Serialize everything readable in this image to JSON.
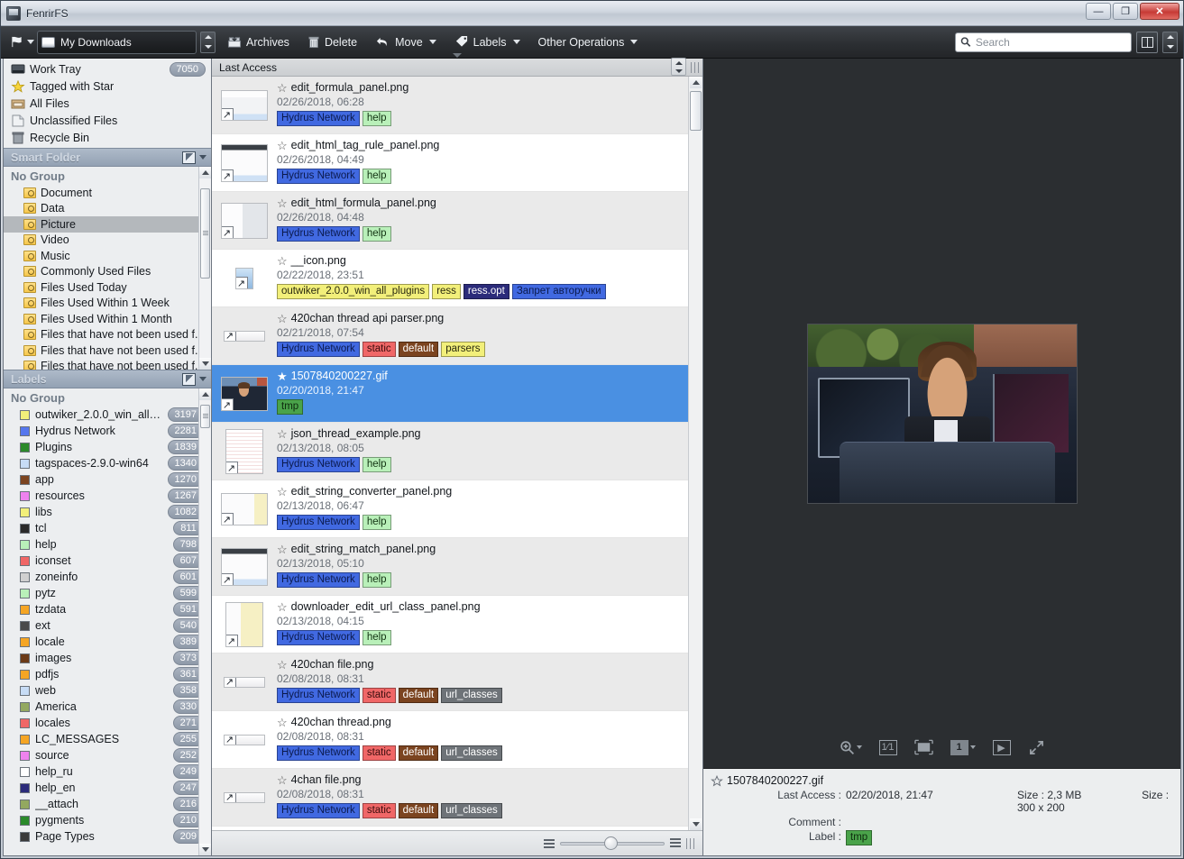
{
  "window": {
    "title": "FenrirFS",
    "app_icon": "app-icon",
    "buttons": {
      "minimize": "—",
      "maximize": "❐",
      "close": "✕"
    }
  },
  "toolbar": {
    "flag_icon": "flag-icon",
    "path_value": "My Downloads",
    "drive_icon": "drive-icon",
    "buttons": [
      {
        "label": "Archives",
        "icon": "archive-box-icon",
        "caret": false
      },
      {
        "label": "Delete",
        "icon": "trash-icon",
        "caret": false
      },
      {
        "label": "Move",
        "icon": "undo-arrow-icon",
        "caret": true
      },
      {
        "label": "Labels",
        "icon": "tag-icon",
        "caret": true
      },
      {
        "label": "Other Operations",
        "icon": "",
        "caret": true
      }
    ],
    "search": {
      "placeholder": "Search",
      "value": "",
      "icon": "search-icon"
    },
    "panel_toggle_icon": "split-panel-icon"
  },
  "sidebar": {
    "fixed_items": [
      {
        "label": "Work Tray",
        "icon": "tray-icon",
        "count": "7050"
      },
      {
        "label": "Tagged with Star",
        "icon": "star-icon",
        "count": ""
      },
      {
        "label": "All Files",
        "icon": "all-files-icon",
        "count": ""
      },
      {
        "label": "Unclassified Files",
        "icon": "unclassified-icon",
        "count": ""
      },
      {
        "label": "Recycle Bin",
        "icon": "recycle-bin-icon",
        "count": ""
      }
    ],
    "smart_folder": {
      "header": "Smart Folder",
      "group": "No Group"
    },
    "smart_items": [
      {
        "label": "Document"
      },
      {
        "label": "Data"
      },
      {
        "label": "Picture",
        "selected": true
      },
      {
        "label": "Video"
      },
      {
        "label": "Music"
      },
      {
        "label": "Commonly Used Files"
      },
      {
        "label": "Files Used Today"
      },
      {
        "label": "Files Used Within 1 Week"
      },
      {
        "label": "Files Used Within 1 Month"
      },
      {
        "label": "Files that have not been used f..."
      },
      {
        "label": "Files that have not been used f..."
      },
      {
        "label": "Files that have not been used f..."
      }
    ],
    "labels_section": {
      "header": "Labels",
      "group": "No Group"
    },
    "labels": [
      {
        "name": "outwiker_2.0.0_win_all_...",
        "count": "3197",
        "color": "#f2ef7a"
      },
      {
        "name": "Hydrus Network",
        "count": "2281",
        "color": "#5577ee"
      },
      {
        "name": "Plugins",
        "count": "1839",
        "color": "#2b8a2b"
      },
      {
        "name": "tagspaces-2.9.0-win64",
        "count": "1340",
        "color": "#c7dcf5"
      },
      {
        "name": "app",
        "count": "1270",
        "color": "#7b4420"
      },
      {
        "name": "resources",
        "count": "1267",
        "color": "#ee82ee"
      },
      {
        "name": "libs",
        "count": "1082",
        "color": "#f2ef7a"
      },
      {
        "name": "tcl",
        "count": "811",
        "color": "#2a2a2a"
      },
      {
        "name": "help",
        "count": "798",
        "color": "#b9f0b9"
      },
      {
        "name": "iconset",
        "count": "607",
        "color": "#f06767"
      },
      {
        "name": "zoneinfo",
        "count": "601",
        "color": "#d0d0d0"
      },
      {
        "name": "pytz",
        "count": "599",
        "color": "#b9f0b9"
      },
      {
        "name": "tzdata",
        "count": "591",
        "color": "#f5a524"
      },
      {
        "name": "ext",
        "count": "540",
        "color": "#4a4a4a"
      },
      {
        "name": "locale",
        "count": "389",
        "color": "#f5a524"
      },
      {
        "name": "images",
        "count": "373",
        "color": "#6b3a18"
      },
      {
        "name": "pdfjs",
        "count": "361",
        "color": "#f5a524"
      },
      {
        "name": "web",
        "count": "358",
        "color": "#c7dcf5"
      },
      {
        "name": "America",
        "count": "330",
        "color": "#93a860"
      },
      {
        "name": "locales",
        "count": "271",
        "color": "#f06767"
      },
      {
        "name": "LC_MESSAGES",
        "count": "255",
        "color": "#f5a524"
      },
      {
        "name": "source",
        "count": "252",
        "color": "#ee82ee"
      },
      {
        "name": "help_ru",
        "count": "249",
        "color": "#ffffff"
      },
      {
        "name": "help_en",
        "count": "247",
        "color": "#2b2b7a"
      },
      {
        "name": "__attach",
        "count": "216",
        "color": "#93a860"
      },
      {
        "name": "pygments",
        "count": "210",
        "color": "#2b8a2b"
      },
      {
        "name": "Page Types",
        "count": "209",
        "color": "#3a3a3a"
      }
    ]
  },
  "list": {
    "header": "Last Access",
    "rows": [
      {
        "name": "edit_formula_panel.png",
        "date": "02/26/2018, 06:28",
        "starred": false,
        "thumb": "doc-light",
        "tags": [
          {
            "text": "Hydrus Network",
            "bg": "#4169e1",
            "fg": "#0b1a4d"
          },
          {
            "text": "help",
            "bg": "#b9f0b9",
            "fg": "#123312"
          }
        ]
      },
      {
        "name": "edit_html_tag_rule_panel.png",
        "date": "02/26/2018, 04:49",
        "starred": false,
        "thumb": "doc-dark-top",
        "tags": [
          {
            "text": "Hydrus Network",
            "bg": "#4169e1",
            "fg": "#0b1a4d"
          },
          {
            "text": "help",
            "bg": "#b9f0b9",
            "fg": "#123312"
          }
        ]
      },
      {
        "name": "edit_html_formula_panel.png",
        "date": "02/26/2018, 04:48",
        "starred": false,
        "thumb": "doc-split",
        "tags": [
          {
            "text": "Hydrus Network",
            "bg": "#4169e1",
            "fg": "#0b1a4d"
          },
          {
            "text": "help",
            "bg": "#b9f0b9",
            "fg": "#123312"
          }
        ]
      },
      {
        "name": "__icon.png",
        "date": "02/22/2018, 23:51",
        "starred": false,
        "thumb": "shortcut-file",
        "tags": [
          {
            "text": "outwiker_2.0.0_win_all_plugins",
            "bg": "#f2ef7a",
            "fg": "#2a2a10"
          },
          {
            "text": "ress",
            "bg": "#f2ef7a",
            "fg": "#2a2a10"
          },
          {
            "text": "ress.opt",
            "bg": "#2b2b7a",
            "fg": "#ffffff"
          },
          {
            "text": "Запрет авторучки",
            "bg": "#4169e1",
            "fg": "#0b1a4d"
          }
        ]
      },
      {
        "name": "420chan thread api parser.png",
        "date": "02/21/2018, 07:54",
        "starred": false,
        "thumb": "wide-thin",
        "tags": [
          {
            "text": "Hydrus Network",
            "bg": "#4169e1",
            "fg": "#0b1a4d"
          },
          {
            "text": "static",
            "bg": "#f06767",
            "fg": "#3a0d0d"
          },
          {
            "text": "default",
            "bg": "#7b4420",
            "fg": "#ffffff"
          },
          {
            "text": "parsers",
            "bg": "#f2ef7a",
            "fg": "#2a2a10"
          }
        ]
      },
      {
        "name": "1507840200227.gif",
        "date": "02/20/2018, 21:47",
        "starred": true,
        "thumb": "photo-car",
        "selected": true,
        "tags": [
          {
            "text": "tmp",
            "bg": "#4aa34a",
            "fg": "#0d2a0d"
          }
        ]
      },
      {
        "name": "json_thread_example.png",
        "date": "02/13/2018, 08:05",
        "starred": false,
        "thumb": "doc-tall-lines",
        "tags": [
          {
            "text": "Hydrus Network",
            "bg": "#4169e1",
            "fg": "#0b1a4d"
          },
          {
            "text": "help",
            "bg": "#b9f0b9",
            "fg": "#123312"
          }
        ]
      },
      {
        "name": "edit_string_converter_panel.png",
        "date": "02/13/2018, 06:47",
        "starred": false,
        "thumb": "doc-yellow",
        "tags": [
          {
            "text": "Hydrus Network",
            "bg": "#4169e1",
            "fg": "#0b1a4d"
          },
          {
            "text": "help",
            "bg": "#b9f0b9",
            "fg": "#123312"
          }
        ]
      },
      {
        "name": "edit_string_match_panel.png",
        "date": "02/13/2018, 05:10",
        "starred": false,
        "thumb": "doc-dark-top",
        "tags": [
          {
            "text": "Hydrus Network",
            "bg": "#4169e1",
            "fg": "#0b1a4d"
          },
          {
            "text": "help",
            "bg": "#b9f0b9",
            "fg": "#123312"
          }
        ]
      },
      {
        "name": "downloader_edit_url_class_panel.png",
        "date": "02/13/2018, 04:15",
        "starred": false,
        "thumb": "doc-yellow-tall",
        "tags": [
          {
            "text": "Hydrus Network",
            "bg": "#4169e1",
            "fg": "#0b1a4d"
          },
          {
            "text": "help",
            "bg": "#b9f0b9",
            "fg": "#123312"
          }
        ]
      },
      {
        "name": "420chan file.png",
        "date": "02/08/2018, 08:31",
        "starred": false,
        "thumb": "wide-thin",
        "tags": [
          {
            "text": "Hydrus Network",
            "bg": "#4169e1",
            "fg": "#0b1a4d"
          },
          {
            "text": "static",
            "bg": "#f06767",
            "fg": "#3a0d0d"
          },
          {
            "text": "default",
            "bg": "#7b4420",
            "fg": "#ffffff"
          },
          {
            "text": "url_classes",
            "bg": "#6e7378",
            "fg": "#ffffff"
          }
        ]
      },
      {
        "name": "420chan thread.png",
        "date": "02/08/2018, 08:31",
        "starred": false,
        "thumb": "wide-thin",
        "tags": [
          {
            "text": "Hydrus Network",
            "bg": "#4169e1",
            "fg": "#0b1a4d"
          },
          {
            "text": "static",
            "bg": "#f06767",
            "fg": "#3a0d0d"
          },
          {
            "text": "default",
            "bg": "#7b4420",
            "fg": "#ffffff"
          },
          {
            "text": "url_classes",
            "bg": "#6e7378",
            "fg": "#ffffff"
          }
        ]
      },
      {
        "name": "4chan file.png",
        "date": "02/08/2018, 08:31",
        "starred": false,
        "thumb": "wide-thin",
        "tags": [
          {
            "text": "Hydrus Network",
            "bg": "#4169e1",
            "fg": "#0b1a4d"
          },
          {
            "text": "static",
            "bg": "#f06767",
            "fg": "#3a0d0d"
          },
          {
            "text": "default",
            "bg": "#7b4420",
            "fg": "#ffffff"
          },
          {
            "text": "url_classes",
            "bg": "#6e7378",
            "fg": "#ffffff"
          }
        ]
      }
    ],
    "footer": {
      "small_icon": "small-thumbs-icon",
      "large_icon": "large-thumbs-icon"
    }
  },
  "preview": {
    "viewer_tools": [
      {
        "icon": "zoom-icon",
        "caret": true,
        "label": ""
      },
      {
        "icon": "actual-size-icon",
        "caret": false,
        "label": "1⁄1"
      },
      {
        "icon": "fit-window-icon",
        "caret": false,
        "label": ""
      },
      {
        "icon": "page-count-icon",
        "caret": true,
        "label": "1"
      },
      {
        "icon": "play-icon",
        "caret": false,
        "label": "▶"
      },
      {
        "icon": "fullscreen-icon",
        "caret": false,
        "label": ""
      }
    ],
    "info": {
      "file_name": "1507840200227.gif",
      "last_access_label": "Last Access :",
      "last_access_value": "02/20/2018, 21:47",
      "size_label": "Size :",
      "size_value": "2,3 MB",
      "dimension_label": "Size :",
      "dimension_value": "300 x 200",
      "comment_label": "Comment :",
      "comment_value": "",
      "label_label": "Label :",
      "label_tag": {
        "text": "tmp",
        "bg": "#4aa34a",
        "fg": "#0d2a0d"
      }
    }
  }
}
